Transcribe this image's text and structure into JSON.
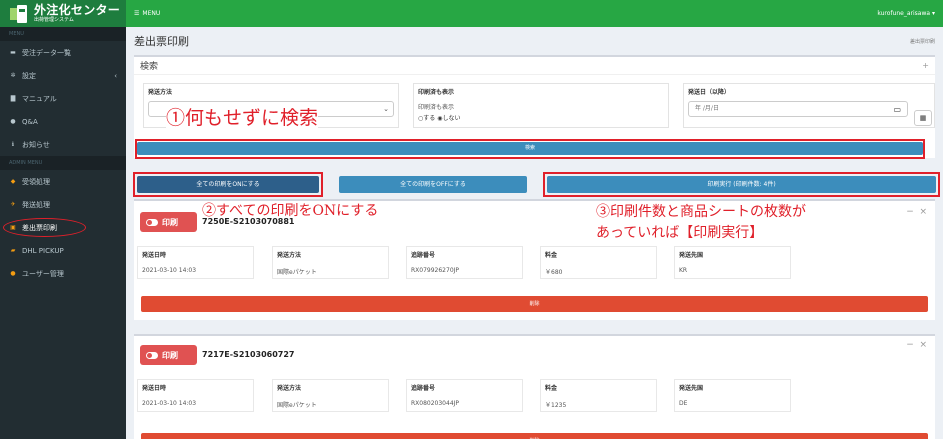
{
  "brand": {
    "title": "外注化センター",
    "subtitle": "出荷管理システム"
  },
  "sidebar": {
    "menu_header": "MENU",
    "admin_header": "ADMIN MENU",
    "items": [
      {
        "label": "受注データ一覧",
        "icon": "list-icon"
      },
      {
        "label": "設定",
        "icon": "gear-icon"
      },
      {
        "label": "マニュアル",
        "icon": "book-icon"
      },
      {
        "label": "Q&A",
        "icon": "question-icon"
      },
      {
        "label": "お知らせ",
        "icon": "info-icon"
      }
    ],
    "admin_items": [
      {
        "label": "受領処理",
        "icon": "cubes-icon"
      },
      {
        "label": "発送処理",
        "icon": "plane-icon"
      },
      {
        "label": "差出票印刷",
        "icon": "printer-icon"
      },
      {
        "label": "DHL PICKUP",
        "icon": "truck-icon"
      },
      {
        "label": "ユーザー管理",
        "icon": "user-icon"
      }
    ]
  },
  "topbar": {
    "menu_label": "MENU",
    "user": "kurofune_arisawa"
  },
  "page": {
    "title": "差出票印刷",
    "breadcrumb": "差出票印刷"
  },
  "search": {
    "title": "検索",
    "method_label": "発送方法",
    "method_value": "",
    "printed_label": "印刷済も表示",
    "printed_hint": "印刷済も表示",
    "radio_yes": "する",
    "radio_no": "しない",
    "date_label": "発送日（以降）",
    "date_placeholder": "年 /月/日",
    "search_button": "検索"
  },
  "actions": {
    "all_on": "全ての印刷をONにする",
    "all_off": "全ての印刷をOFFにする",
    "execute": "印刷実行 (印刷件数: 4件)"
  },
  "annotations": {
    "a1": "①何もせずに検索",
    "a2": "②すべての印刷をONにする",
    "a3_line1": "③印刷件数と商品シートの枚数が",
    "a3_line2": "あっていれば【印刷実行】"
  },
  "orders": [
    {
      "print_label": "印刷",
      "order_no": "7250E-S2103070881",
      "fields": [
        {
          "label": "発送日時",
          "value": "2021-03-10 14:03"
        },
        {
          "label": "発送方法",
          "value": "国際eパケット"
        },
        {
          "label": "追跡番号",
          "value": "RX079926270JP"
        },
        {
          "label": "料金",
          "value": "￥680"
        },
        {
          "label": "発送先国",
          "value": "KR"
        }
      ],
      "delete_label": "削除"
    },
    {
      "print_label": "印刷",
      "order_no": "7217E-S2103060727",
      "fields": [
        {
          "label": "発送日時",
          "value": "2021-03-10 14:03"
        },
        {
          "label": "発送方法",
          "value": "国際eパケット"
        },
        {
          "label": "追跡番号",
          "value": "RX080203044JP"
        },
        {
          "label": "料金",
          "value": "￥1235"
        },
        {
          "label": "発送先国",
          "value": "DE"
        }
      ],
      "delete_label": "削除"
    }
  ],
  "colors": {
    "topbar": "#27a744",
    "sidebar": "#222d32",
    "primary": "#3c8dbc",
    "danger": "#e04b32",
    "annotation": "#e0202a"
  }
}
